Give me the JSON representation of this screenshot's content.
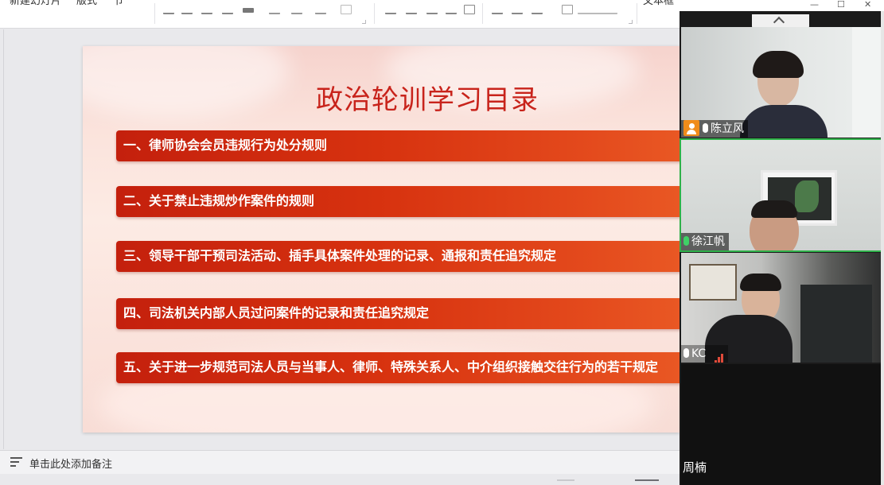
{
  "window": {
    "minimize": "—",
    "maximize": "☐",
    "close": "✕"
  },
  "toolbar": {
    "new_slide": "新建幻灯片",
    "layout": "版式",
    "section": "节",
    "right_label": "文本框"
  },
  "slide": {
    "title": "政治轮训学习目录",
    "items": [
      "一、律师协会会员违规行为处分规则",
      "二、关于禁止违规炒作案件的规则",
      "三、领导干部干预司法活动、插手具体案件处理的记录、通报和责任追究规定",
      "四、司法机关内部人员过问案件的记录和责任追究规定",
      "五、关于进一步规范司法人员与当事人、律师、特殊关系人、中介组织接触交往行为的若干规定"
    ]
  },
  "notes": {
    "placeholder": "单击此处添加备注"
  },
  "video": {
    "participants": [
      {
        "name": "陈立风",
        "role": "host",
        "mic": "on"
      },
      {
        "name": "徐江帆",
        "role": "speaker",
        "mic": "active"
      },
      {
        "name": "KC",
        "role": "participant",
        "mic": "muted"
      },
      {
        "name": "周楠",
        "role": "participant",
        "mic": "none"
      }
    ]
  },
  "colors": {
    "title_red": "#c8231b",
    "bar_red": "#d7320f",
    "active_speaker_green": "#2fb14a",
    "host_badge_orange": "#f08c1a"
  }
}
